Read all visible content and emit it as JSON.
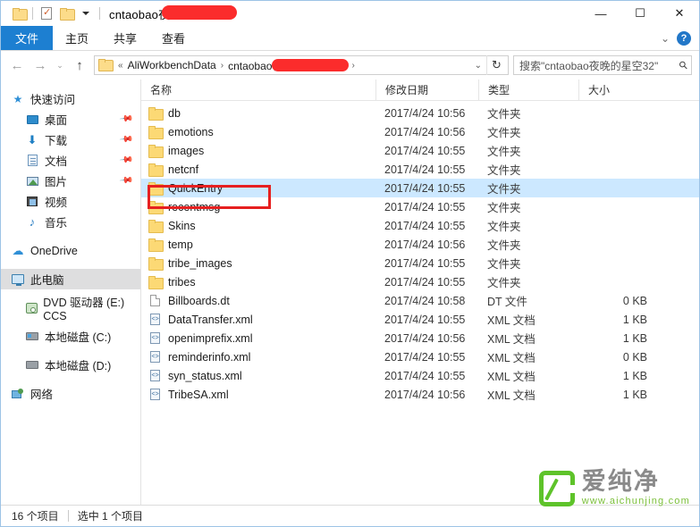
{
  "window": {
    "title": "cntaobao夜",
    "title_redacted": true,
    "controls": {
      "minimize": "—",
      "maximize": "☐",
      "close": "✕"
    }
  },
  "quick_access_toolbar": {
    "items": [
      {
        "name": "folder-icon",
        "label": ""
      },
      {
        "name": "properties-icon",
        "label": ""
      },
      {
        "name": "new-folder-icon",
        "label": ""
      },
      {
        "name": "chevron-down-icon",
        "label": ""
      }
    ]
  },
  "ribbon": {
    "tabs": [
      {
        "label": "文件",
        "active": true
      },
      {
        "label": "主页",
        "active": false
      },
      {
        "label": "共享",
        "active": false
      },
      {
        "label": "查看",
        "active": false
      }
    ],
    "expand_label": "⌄",
    "help_label": "?"
  },
  "address_bar": {
    "back": "←",
    "forward": "→",
    "recent": "⌄",
    "up": "↑",
    "breadcrumb_overflow": "«",
    "crumbs": [
      "AliWorkbenchData",
      "cntaobao夜"
    ],
    "crumb_separator": "›",
    "dropdown": "⌄",
    "refresh": "↻"
  },
  "search": {
    "placeholder": "搜索\"cntaobao夜晚的星空32\"",
    "icon": "search-icon"
  },
  "sidebar": {
    "groups": [
      {
        "label": "快速访问",
        "icon": "star-icon",
        "items": [
          {
            "label": "桌面",
            "icon": "desktop-icon",
            "pinned": true
          },
          {
            "label": "下载",
            "icon": "download-icon",
            "pinned": true
          },
          {
            "label": "文档",
            "icon": "document-icon",
            "pinned": true
          },
          {
            "label": "图片",
            "icon": "pictures-icon",
            "pinned": true
          },
          {
            "label": "视频",
            "icon": "video-icon",
            "pinned": false
          },
          {
            "label": "音乐",
            "icon": "music-icon",
            "pinned": false
          }
        ]
      },
      {
        "label": "OneDrive",
        "icon": "cloud-icon",
        "items": []
      },
      {
        "label": "此电脑",
        "icon": "this-pc-icon",
        "selected": true,
        "items": [
          {
            "label": "DVD 驱动器 (E:) CCS",
            "icon": "dvd-drive-icon",
            "pinned": false
          },
          {
            "label": "本地磁盘 (C:)",
            "icon": "system-drive-icon",
            "pinned": false
          },
          {
            "label": "本地磁盘 (D:)",
            "icon": "drive-icon",
            "pinned": false
          }
        ]
      },
      {
        "label": "网络",
        "icon": "network-icon",
        "items": []
      }
    ]
  },
  "filelist": {
    "columns": [
      {
        "key": "name",
        "label": "名称"
      },
      {
        "key": "date",
        "label": "修改日期"
      },
      {
        "key": "type",
        "label": "类型"
      },
      {
        "key": "size",
        "label": "大小"
      }
    ],
    "rows": [
      {
        "name": "db",
        "date": "2017/4/24 10:56",
        "type": "文件夹",
        "size": "",
        "icon": "folder-icon",
        "selected": false
      },
      {
        "name": "emotions",
        "date": "2017/4/24 10:56",
        "type": "文件夹",
        "size": "",
        "icon": "folder-icon",
        "selected": false
      },
      {
        "name": "images",
        "date": "2017/4/24 10:55",
        "type": "文件夹",
        "size": "",
        "icon": "folder-icon",
        "selected": false
      },
      {
        "name": "netcnf",
        "date": "2017/4/24 10:55",
        "type": "文件夹",
        "size": "",
        "icon": "folder-icon",
        "selected": false
      },
      {
        "name": "QuickEntry",
        "date": "2017/4/24 10:55",
        "type": "文件夹",
        "size": "",
        "icon": "folder-icon",
        "selected": true
      },
      {
        "name": "recentmsg",
        "date": "2017/4/24 10:55",
        "type": "文件夹",
        "size": "",
        "icon": "folder-icon",
        "selected": false
      },
      {
        "name": "Skins",
        "date": "2017/4/24 10:55",
        "type": "文件夹",
        "size": "",
        "icon": "folder-icon",
        "selected": false
      },
      {
        "name": "temp",
        "date": "2017/4/24 10:56",
        "type": "文件夹",
        "size": "",
        "icon": "folder-icon",
        "selected": false
      },
      {
        "name": "tribe_images",
        "date": "2017/4/24 10:55",
        "type": "文件夹",
        "size": "",
        "icon": "folder-icon",
        "selected": false
      },
      {
        "name": "tribes",
        "date": "2017/4/24 10:55",
        "type": "文件夹",
        "size": "",
        "icon": "folder-icon",
        "selected": false
      },
      {
        "name": "Billboards.dt",
        "date": "2017/4/24 10:58",
        "type": "DT 文件",
        "size": "0 KB",
        "icon": "generic-file-icon",
        "selected": false
      },
      {
        "name": "DataTransfer.xml",
        "date": "2017/4/24 10:55",
        "type": "XML 文档",
        "size": "1 KB",
        "icon": "xml-file-icon",
        "selected": false
      },
      {
        "name": "openimprefix.xml",
        "date": "2017/4/24 10:56",
        "type": "XML 文档",
        "size": "1 KB",
        "icon": "xml-file-icon",
        "selected": false
      },
      {
        "name": "reminderinfo.xml",
        "date": "2017/4/24 10:55",
        "type": "XML 文档",
        "size": "0 KB",
        "icon": "xml-file-icon",
        "selected": false
      },
      {
        "name": "syn_status.xml",
        "date": "2017/4/24 10:55",
        "type": "XML 文档",
        "size": "1 KB",
        "icon": "xml-file-icon",
        "selected": false
      },
      {
        "name": "TribeSA.xml",
        "date": "2017/4/24 10:56",
        "type": "XML 文档",
        "size": "1 KB",
        "icon": "xml-file-icon",
        "selected": false
      }
    ]
  },
  "statusbar": {
    "item_count": "16 个项目",
    "selection": "选中 1 个项目"
  },
  "annotation": {
    "target": "QuickEntry",
    "color": "#e62020"
  },
  "watermark": {
    "name": "爱纯净",
    "url": "www.aichunjing.com",
    "color": "#5ec32a"
  },
  "colors": {
    "accent": "#1d7fd1",
    "selection": "#cce8ff",
    "folder": "#fcd975",
    "annotation": "#e62020",
    "redaction": "#fb2c2c"
  }
}
